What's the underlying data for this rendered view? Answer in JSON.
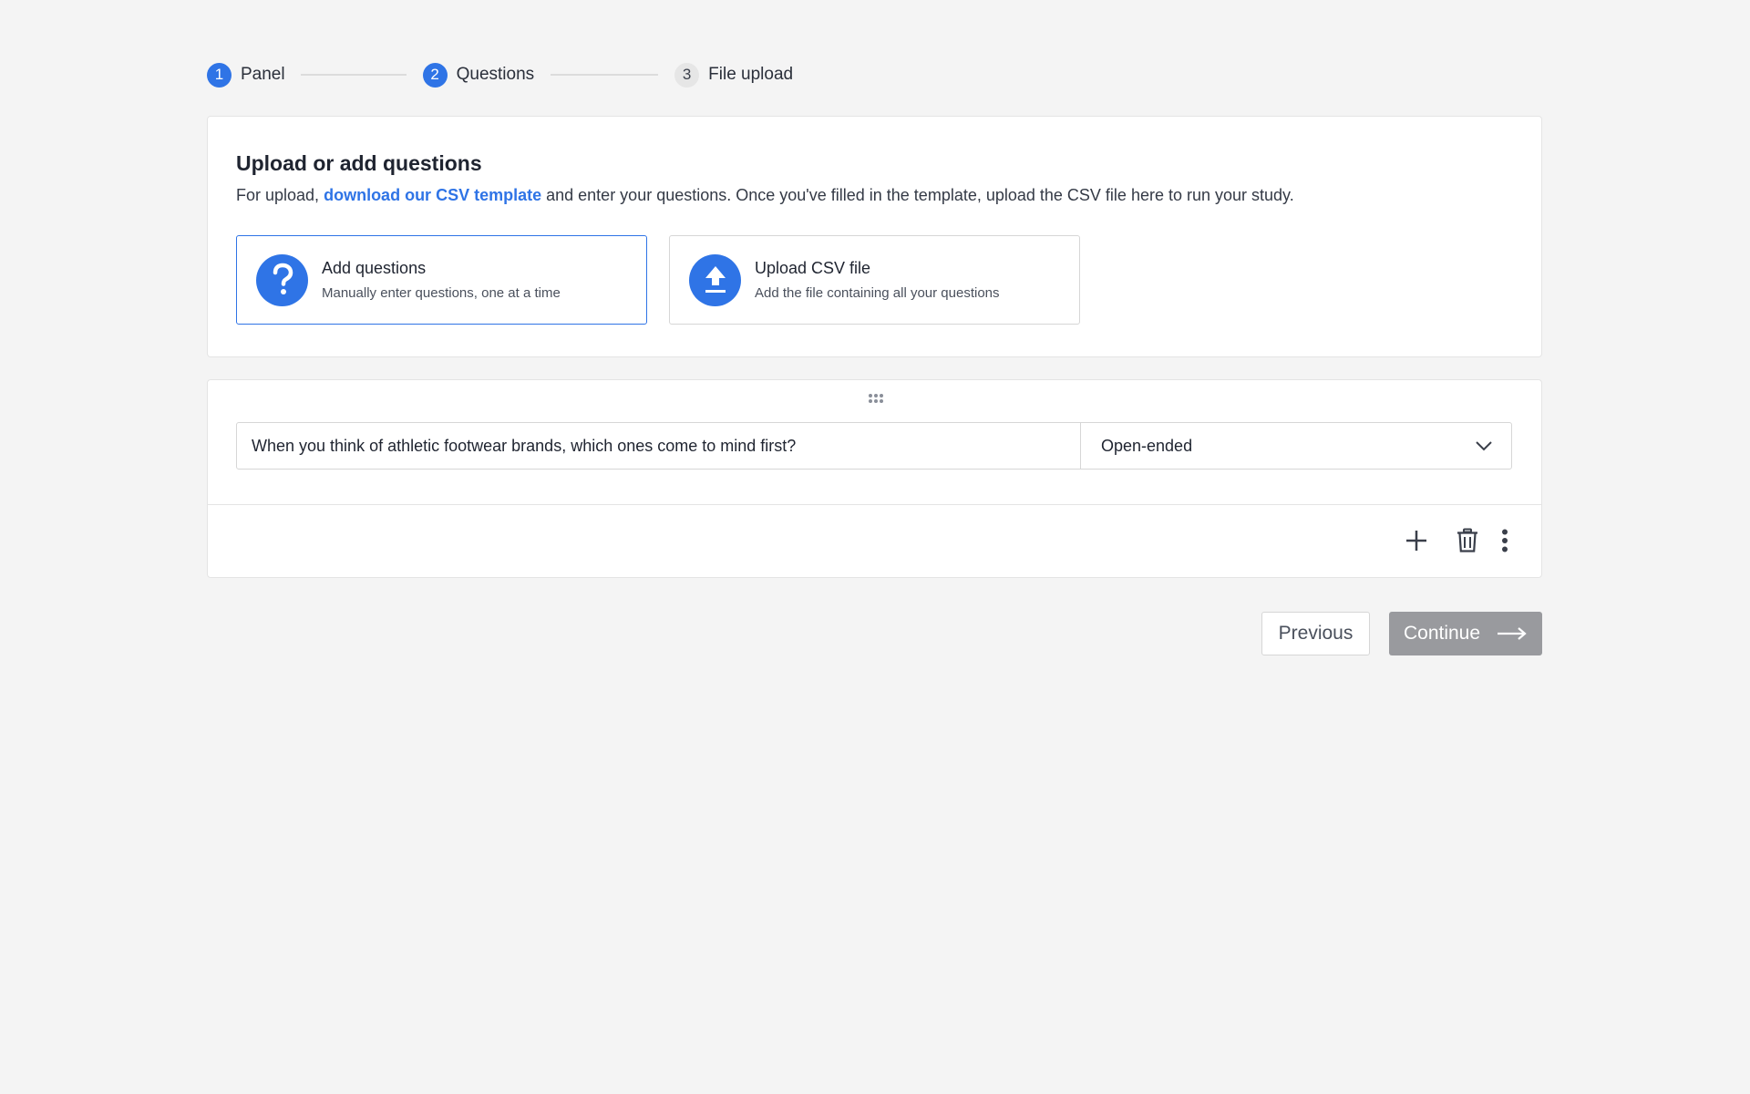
{
  "stepper": {
    "steps": [
      {
        "number": "1",
        "label": "Panel",
        "state": "done"
      },
      {
        "number": "2",
        "label": "Questions",
        "state": "active"
      },
      {
        "number": "3",
        "label": "File upload",
        "state": "pending"
      }
    ]
  },
  "upload_card": {
    "title": "Upload or add questions",
    "desc_prefix": "For upload,",
    "desc_link": "download our CSV template",
    "desc_suffix": "and enter your questions. Once you've filled in the template, upload the CSV file here to run your study.",
    "options": [
      {
        "title": "Add questions",
        "subtitle": "Manually enter questions, one at a time",
        "icon": "question-icon",
        "selected": true
      },
      {
        "title": "Upload CSV file",
        "subtitle": "Add the file containing all your questions",
        "icon": "upload-icon",
        "selected": false
      }
    ]
  },
  "question_card": {
    "question_value": "When you think of athletic footwear brands, which ones come to mind first?",
    "question_type": "Open-ended"
  },
  "footer": {
    "previous_label": "Previous",
    "continue_label": "Continue"
  },
  "colors": {
    "accent": "#2f74e6",
    "continue_disabled": "#999a9e",
    "background": "#f4f4f4"
  }
}
